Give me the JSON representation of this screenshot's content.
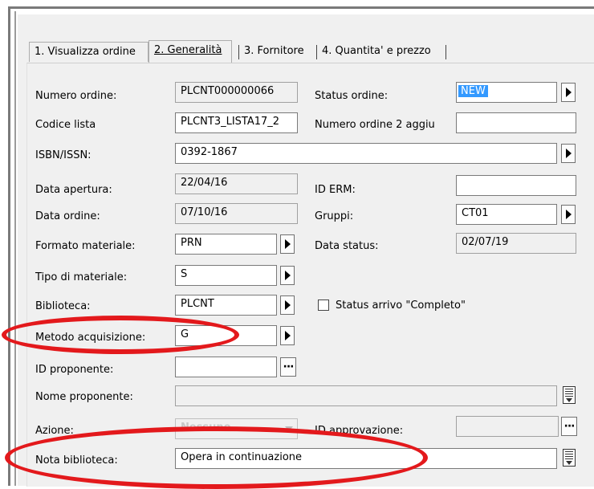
{
  "tabs": [
    {
      "label": "1. Visualizza ordine"
    },
    {
      "label": "2. Generalità"
    },
    {
      "label": "3. Fornitore"
    },
    {
      "label": "4. Quantita' e prezzo"
    }
  ],
  "form": {
    "numero_ordine": {
      "label": "Numero ordine:",
      "value": "PLCNT000000066"
    },
    "status_ordine": {
      "label": "Status ordine:",
      "value": "NEW"
    },
    "codice_lista": {
      "label": "Codice lista",
      "value": "PLCNT3_LISTA17_2"
    },
    "numero_ordine_2": {
      "label": "Numero ordine 2 aggiu",
      "value": ""
    },
    "isbn": {
      "label": "ISBN/ISSN:",
      "value": "0392-1867"
    },
    "data_apertura": {
      "label": "Data apertura:",
      "value": "22/04/16"
    },
    "id_erm": {
      "label": "ID ERM:",
      "value": ""
    },
    "data_ordine": {
      "label": "Data ordine:",
      "value": "07/10/16"
    },
    "gruppi": {
      "label": "Gruppi:",
      "value": "CT01"
    },
    "formato_materiale": {
      "label": "Formato materiale:",
      "value": "PRN"
    },
    "data_status": {
      "label": "Data status:",
      "value": "02/07/19"
    },
    "tipo_materiale": {
      "label": "Tipo di materiale:",
      "value": "S"
    },
    "biblioteca": {
      "label": "Biblioteca:",
      "value": "PLCNT"
    },
    "status_arrivo": {
      "label": "Status arrivo \"Completo\"",
      "checked": false
    },
    "metodo_acquisizione": {
      "label": "Metodo acquisizione:",
      "value": "G"
    },
    "id_proponente": {
      "label": "ID proponente:",
      "value": ""
    },
    "nome_proponente": {
      "label": "Nome proponente:",
      "value": ""
    },
    "azione": {
      "label": "Azione:",
      "value": "Nessuno"
    },
    "id_approvazione": {
      "label": "ID approvazione:",
      "value": ""
    },
    "nota_biblioteca": {
      "label": "Nota biblioteca:",
      "value": "Opera in continuazione"
    }
  },
  "annotations": {
    "highlight_color": "#e3191c"
  }
}
